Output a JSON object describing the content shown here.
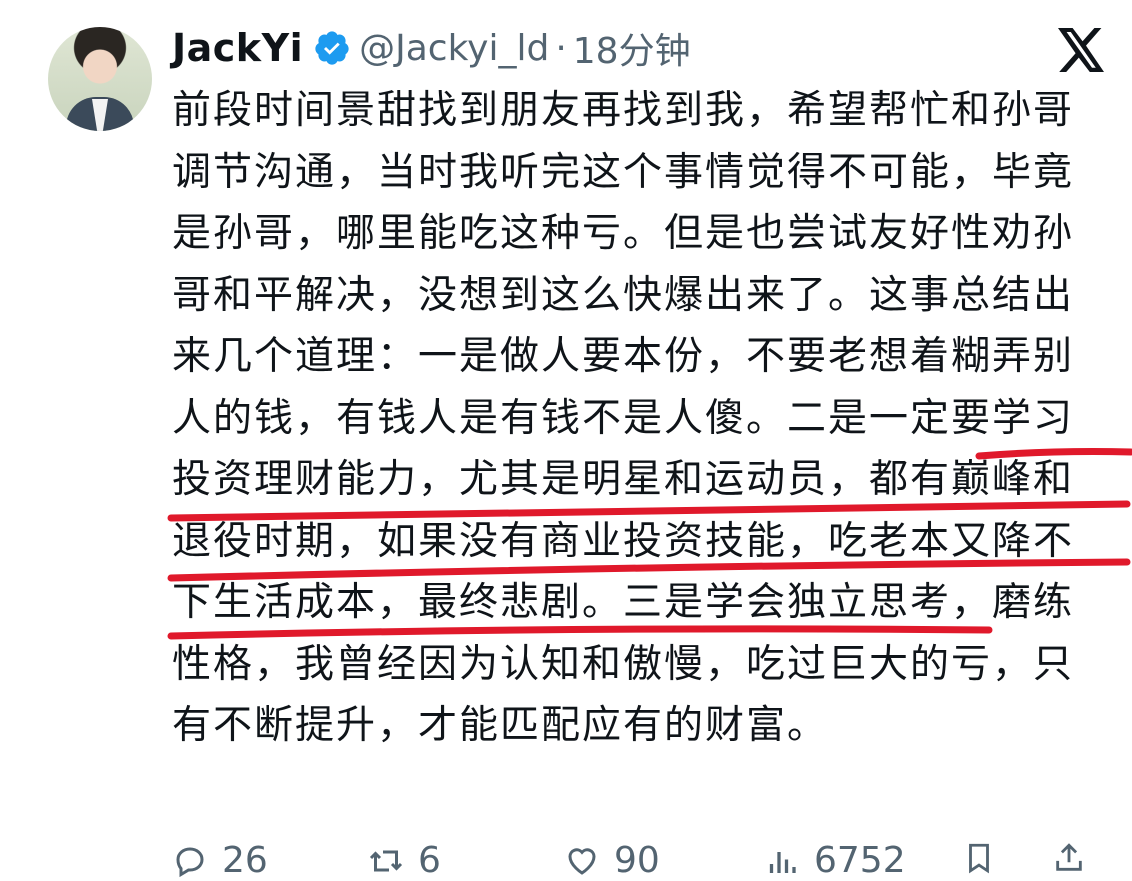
{
  "post": {
    "author_name": "JackYi",
    "handle": "@Jackyi_ld",
    "separator": "·",
    "time": "18分钟",
    "text": "前段时间景甜找到朋友再找到我，希望帮忙和孙哥调节沟通，当时我听完这个事情觉得不可能，毕竟是孙哥，哪里能吃这种亏。但是也尝试友好性劝孙哥和平解决，没想到这么快爆出来了。这事总结出来几个道理：一是做人要本份，不要老想着糊弄别人的钱，有钱人是有钱不是人傻。二是一定要学习投资理财能力，尤其是明星和运动员，都有巅峰和退役时期，如果没有商业投资技能，吃老本又降不下生活成本，最终悲剧。三是学会独立思考，磨练性格，我曾经因为认知和傲慢，吃过巨大的亏，只有不断提升，才能匹配应有的财富。"
  },
  "icons": {
    "verified": "verified-badge-icon",
    "brand": "x-logo-icon",
    "reply": "reply-icon",
    "repost": "repost-icon",
    "like": "like-icon",
    "views": "views-icon"
  },
  "actions": {
    "replies": "26",
    "reposts": "6",
    "likes": "90",
    "views": "6752"
  },
  "colors": {
    "verified_blue": "#1d9bf0",
    "underline_red": "#e0192b",
    "secondary_text": "#536471"
  }
}
